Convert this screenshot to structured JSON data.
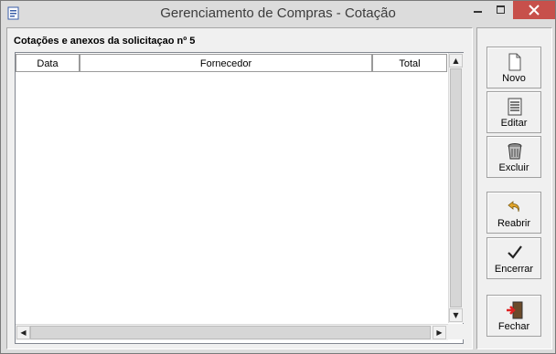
{
  "window": {
    "title": "Gerenciamento de Compras - Cotação"
  },
  "panel": {
    "heading": "Cotações e anexos da solicitaçao nº 5"
  },
  "grid": {
    "columns": [
      "Data",
      "Fornecedor",
      "Total"
    ],
    "rows": []
  },
  "buttons": {
    "novo": "Novo",
    "editar": "Editar",
    "excluir": "Excluir",
    "reabrir": "Reabrir",
    "encerrar": "Encerrar",
    "fechar": "Fechar"
  },
  "colors": {
    "close_button": "#c7504b",
    "window_bg": "#dcdcdc",
    "panel_bg": "#f0f0f0"
  }
}
